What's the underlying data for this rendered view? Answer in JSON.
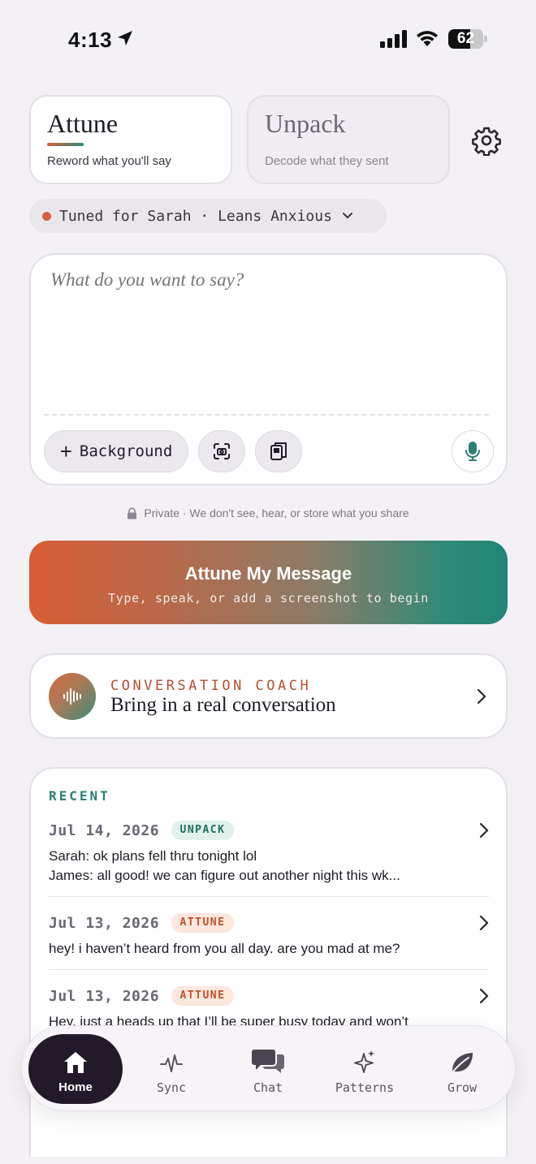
{
  "status_bar": {
    "time": "4:13",
    "battery": "62",
    "battery_level_percent": 62
  },
  "modes": [
    {
      "title": "Attune",
      "subtitle": "Reword what you'll say",
      "active": true
    },
    {
      "title": "Unpack",
      "subtitle": "Decode what they sent",
      "active": false
    }
  ],
  "tuned": {
    "label": "Tuned for Sarah · Leans Anxious",
    "dot_color": "#d6603e"
  },
  "compose": {
    "placeholder": "What do you want to say?",
    "background_button": "Background",
    "screenshot_icon": "camera-scan-icon",
    "paste_icon": "clipboard-icon",
    "mic_icon": "microphone-icon"
  },
  "privacy_note": "Private · We don't see, hear, or store what you share",
  "cta": {
    "title": "Attune My Message",
    "subtitle": "Type, speak, or add a screenshot to begin",
    "gradient": [
      "#d85d35",
      "#1f8676"
    ]
  },
  "coach": {
    "label": "CONVERSATION COACH",
    "title": "Bring in a real conversation",
    "icon": "waveform-icon"
  },
  "recent": {
    "title": "RECENT",
    "items": [
      {
        "date": "Jul 14, 2026",
        "badge": "UNPACK",
        "line1": "Sarah: ok plans fell thru tonight lol",
        "line2": "James: all good! we can figure out another night this wk..."
      },
      {
        "date": "Jul 13, 2026",
        "badge": "ATTUNE",
        "line1": "hey! i haven’t heard from you all day. are you mad at me?",
        "line2": ""
      },
      {
        "date": "Jul 13, 2026",
        "badge": "ATTUNE",
        "line1": "Hey, just a heads up that I’ll be super busy today and won’t",
        "line2": ""
      }
    ]
  },
  "nav": [
    {
      "label": "Home",
      "icon": "home-icon",
      "active": true
    },
    {
      "label": "Sync",
      "icon": "pulse-icon",
      "active": false
    },
    {
      "label": "Chat",
      "icon": "chat-bubbles-icon",
      "active": false
    },
    {
      "label": "Patterns",
      "icon": "sparkles-icon",
      "active": false
    },
    {
      "label": "Grow",
      "icon": "leaf-icon",
      "active": false
    }
  ],
  "colors": {
    "accent_orange": "#d6603e",
    "accent_teal": "#2a8170",
    "background": "#f3f1f5"
  }
}
